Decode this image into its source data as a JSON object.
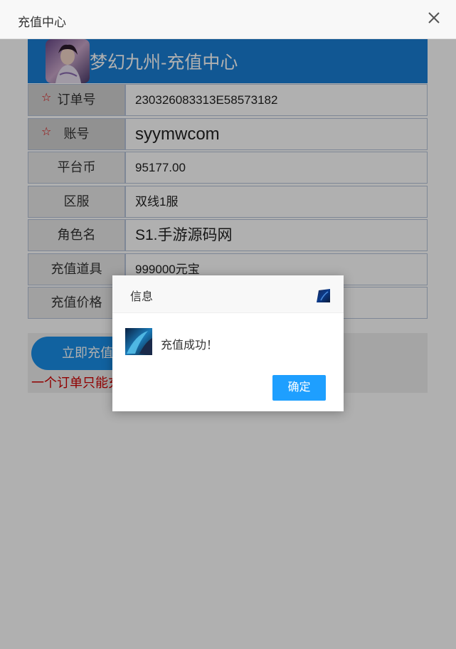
{
  "window": {
    "title": "充值中心"
  },
  "banner": {
    "title": "梦幻九州-充值中心"
  },
  "form": {
    "rows": [
      {
        "label": "订单号",
        "value": "230326083313E58573182",
        "required": true
      },
      {
        "label": "账号",
        "value": "syymwcom",
        "required": true
      },
      {
        "label": "平台币",
        "value": "95177.00",
        "required": false
      },
      {
        "label": "区服",
        "value": "双线1服",
        "required": false
      },
      {
        "label": "角色名",
        "value": "S1.手游源码网",
        "required": false
      },
      {
        "label": "充值道具",
        "value": "999000元宝",
        "required": false
      },
      {
        "label": "充值价格",
        "value": "",
        "required": false
      }
    ]
  },
  "actions": {
    "submit_label": "立即充值",
    "notice": "一个订单只能充"
  },
  "dialog": {
    "title": "信息",
    "message": "充值成功！",
    "confirm_label": "确定"
  },
  "colors": {
    "banner": "#1a7fd6",
    "primary_button": "#1e9fff",
    "notice_red": "#d10000",
    "required_star": "#dd0000"
  },
  "icons": {
    "close": "close-icon",
    "game": "game-avatar-icon",
    "success": "success-icon"
  }
}
